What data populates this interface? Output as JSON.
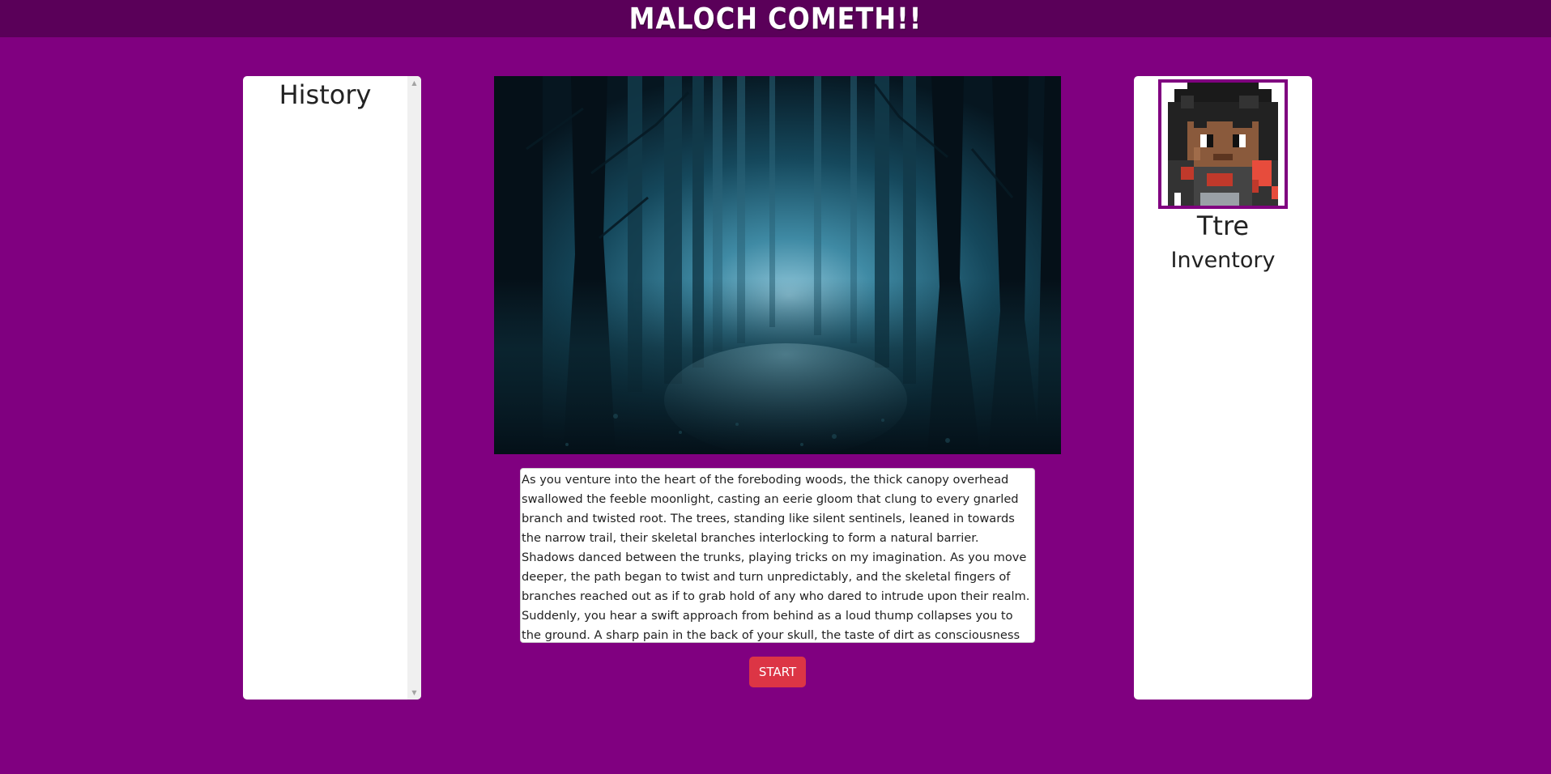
{
  "header": {
    "title": "MALOCH COMETH!!"
  },
  "history": {
    "title": "History",
    "scroll_up_icon": "triangle-up-icon",
    "scroll_down_icon": "triangle-down-icon"
  },
  "scene": {
    "image": "dark-foggy-forest-path"
  },
  "story": {
    "text": "As you venture into the heart of the foreboding woods, the thick canopy overhead swallowed the feeble moonlight, casting an eerie gloom that clung to every gnarled branch and twisted root. The trees, standing like silent sentinels, leaned in towards the narrow trail, their skeletal branches interlocking to form a natural barrier. Shadows danced between the trunks, playing tricks on my imagination. As you move deeper, the path began to twist and turn unpredictably, and the skeletal fingers of branches reached out as if to grab hold of any who dared to intrude upon their realm. Suddenly, you hear a swift approach from behind as a loud thump collapses you to the ground. A sharp pain in the back of your skull, the taste of dirt as consciousness fades."
  },
  "actions": {
    "start_label": "START"
  },
  "character": {
    "name": "Ttre",
    "inventory_title": "Inventory",
    "avatar": "pixel-art-character-portrait"
  },
  "colors": {
    "background": "#800080",
    "topbar": "#5a0059",
    "start_button": "#dc3545",
    "avatar_border": "#800080"
  }
}
